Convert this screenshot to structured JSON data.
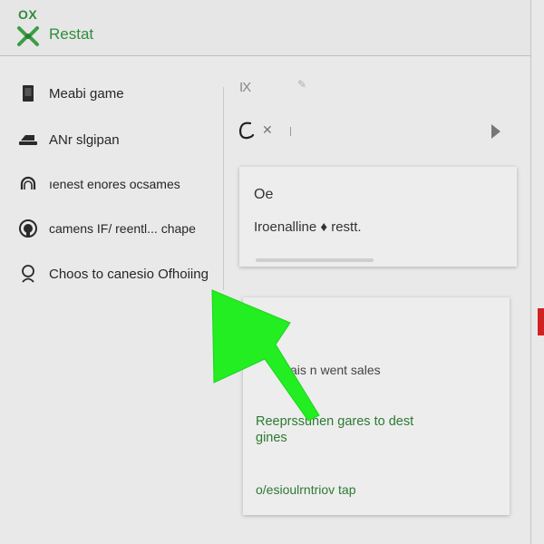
{
  "header": {
    "brand_small": "OX",
    "title": "Restat",
    "logo_color": "#3a9e45"
  },
  "sidebar": {
    "items": [
      {
        "label": "Meabi game",
        "icon": "tablet-icon"
      },
      {
        "label": "ANr slgipan",
        "icon": "laptop-icon"
      },
      {
        "label": "ıenest enores ocsames",
        "icon": "headset-icon"
      },
      {
        "label": "camens IF/ reentl... chape",
        "icon": "controller-icon"
      },
      {
        "label": "Choos to canesio Ofhoiing",
        "icon": "user-icon"
      }
    ]
  },
  "main": {
    "toolbar_close": "IX",
    "filter_row": {
      "tag_icon": "tag-icon",
      "close_icon": "close-icon",
      "next_icon": "play-icon"
    },
    "card1": {
      "title": "Oe",
      "text": "Iroenalline ♦ restt."
    },
    "card2": {
      "line_a": "ais n went sales",
      "line_b": "Reeprssunen gares to dest gines",
      "line_c": "o/esioulrntriov tap"
    }
  },
  "colors": {
    "accent_green": "#2f8d3c",
    "pointer_green": "#22ee22",
    "marker_red": "#d12222"
  }
}
